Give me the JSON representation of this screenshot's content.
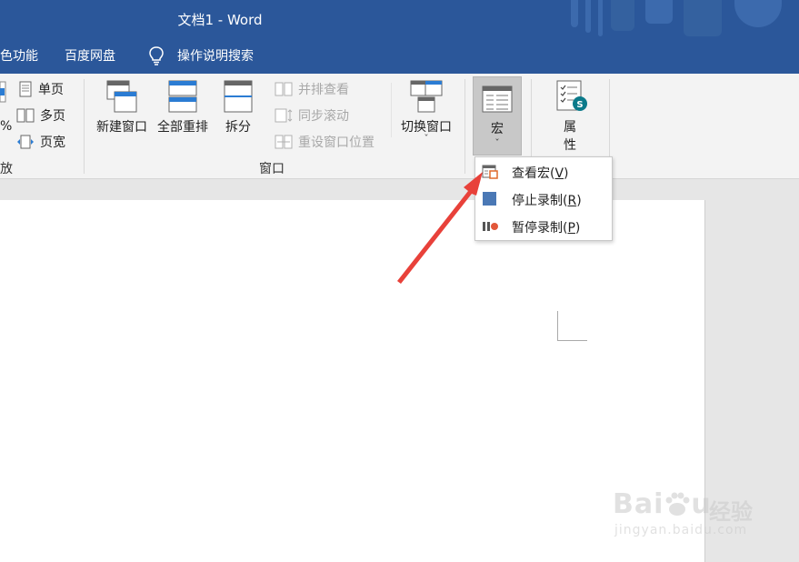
{
  "window": {
    "title": "文档1  -  Word"
  },
  "tabs": [
    {
      "label": "色功能"
    },
    {
      "label": "百度网盘"
    },
    {
      "label": "操作说明搜索"
    }
  ],
  "ribbon": {
    "zoom_group": {
      "percent_label": "%",
      "group_label": "放",
      "one_page": "单页",
      "multi_page": "多页",
      "page_width": "页宽"
    },
    "window_group": {
      "new_window": "新建窗口",
      "arrange_all": "全部重排",
      "split": "拆分",
      "side_by_side": "并排查看",
      "sync_scroll": "同步滚动",
      "reset_window": "重设窗口位置",
      "switch_window": "切换窗口",
      "switch_window_caret": "ˇ",
      "group_label": "窗口"
    },
    "macro_group": {
      "macro": "宏",
      "macro_caret": "ˇ"
    },
    "properties_group": {
      "properties_line1": "属",
      "properties_line2": "性"
    }
  },
  "macro_menu": {
    "items": [
      {
        "label": "查看宏(",
        "key": "V",
        "suffix": ")",
        "icon": "view-macros-icon"
      },
      {
        "label": "停止录制(",
        "key": "R",
        "suffix": ")",
        "icon": "stop-recording-icon"
      },
      {
        "label": "暂停录制(",
        "key": "P",
        "suffix": ")",
        "icon": "pause-recording-icon"
      }
    ]
  },
  "watermark": {
    "brand": "Bai",
    "brand_suffix": "u",
    "cn": "经验",
    "url": "jingyan.baidu.com"
  },
  "colors": {
    "titlebar": "#2b579a",
    "ribbon": "#f3f3f3",
    "accent_orange": "#e06a2c",
    "arrow_red": "#e8413a"
  }
}
